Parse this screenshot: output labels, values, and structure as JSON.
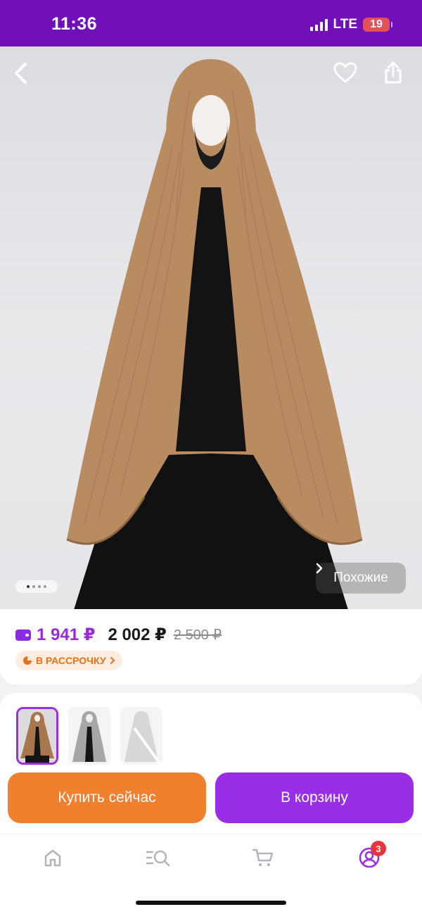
{
  "status_bar": {
    "time": "11:36",
    "network": "LTE",
    "battery": "19"
  },
  "product": {
    "image_alt": "Brown pleated hijab on mannequin",
    "similar_label": "Похожие",
    "carousel": {
      "count": 4,
      "active": 1
    }
  },
  "pricing": {
    "wallet_price": "1 941 ₽",
    "regular_price": "2 002 ₽",
    "old_price": "2 500 ₽",
    "installment_label": "В РАССРОЧКУ"
  },
  "actions": {
    "buy_now": "Купить сейчас",
    "add_to_cart": "В корзину"
  },
  "tabbar": {
    "profile_badge": "3"
  },
  "colors": {
    "brand_purple": "#7110b8",
    "buy_orange": "#f07f2e",
    "cart_purple": "#9a2ee6",
    "wallet_price": "#9a2ad9"
  }
}
